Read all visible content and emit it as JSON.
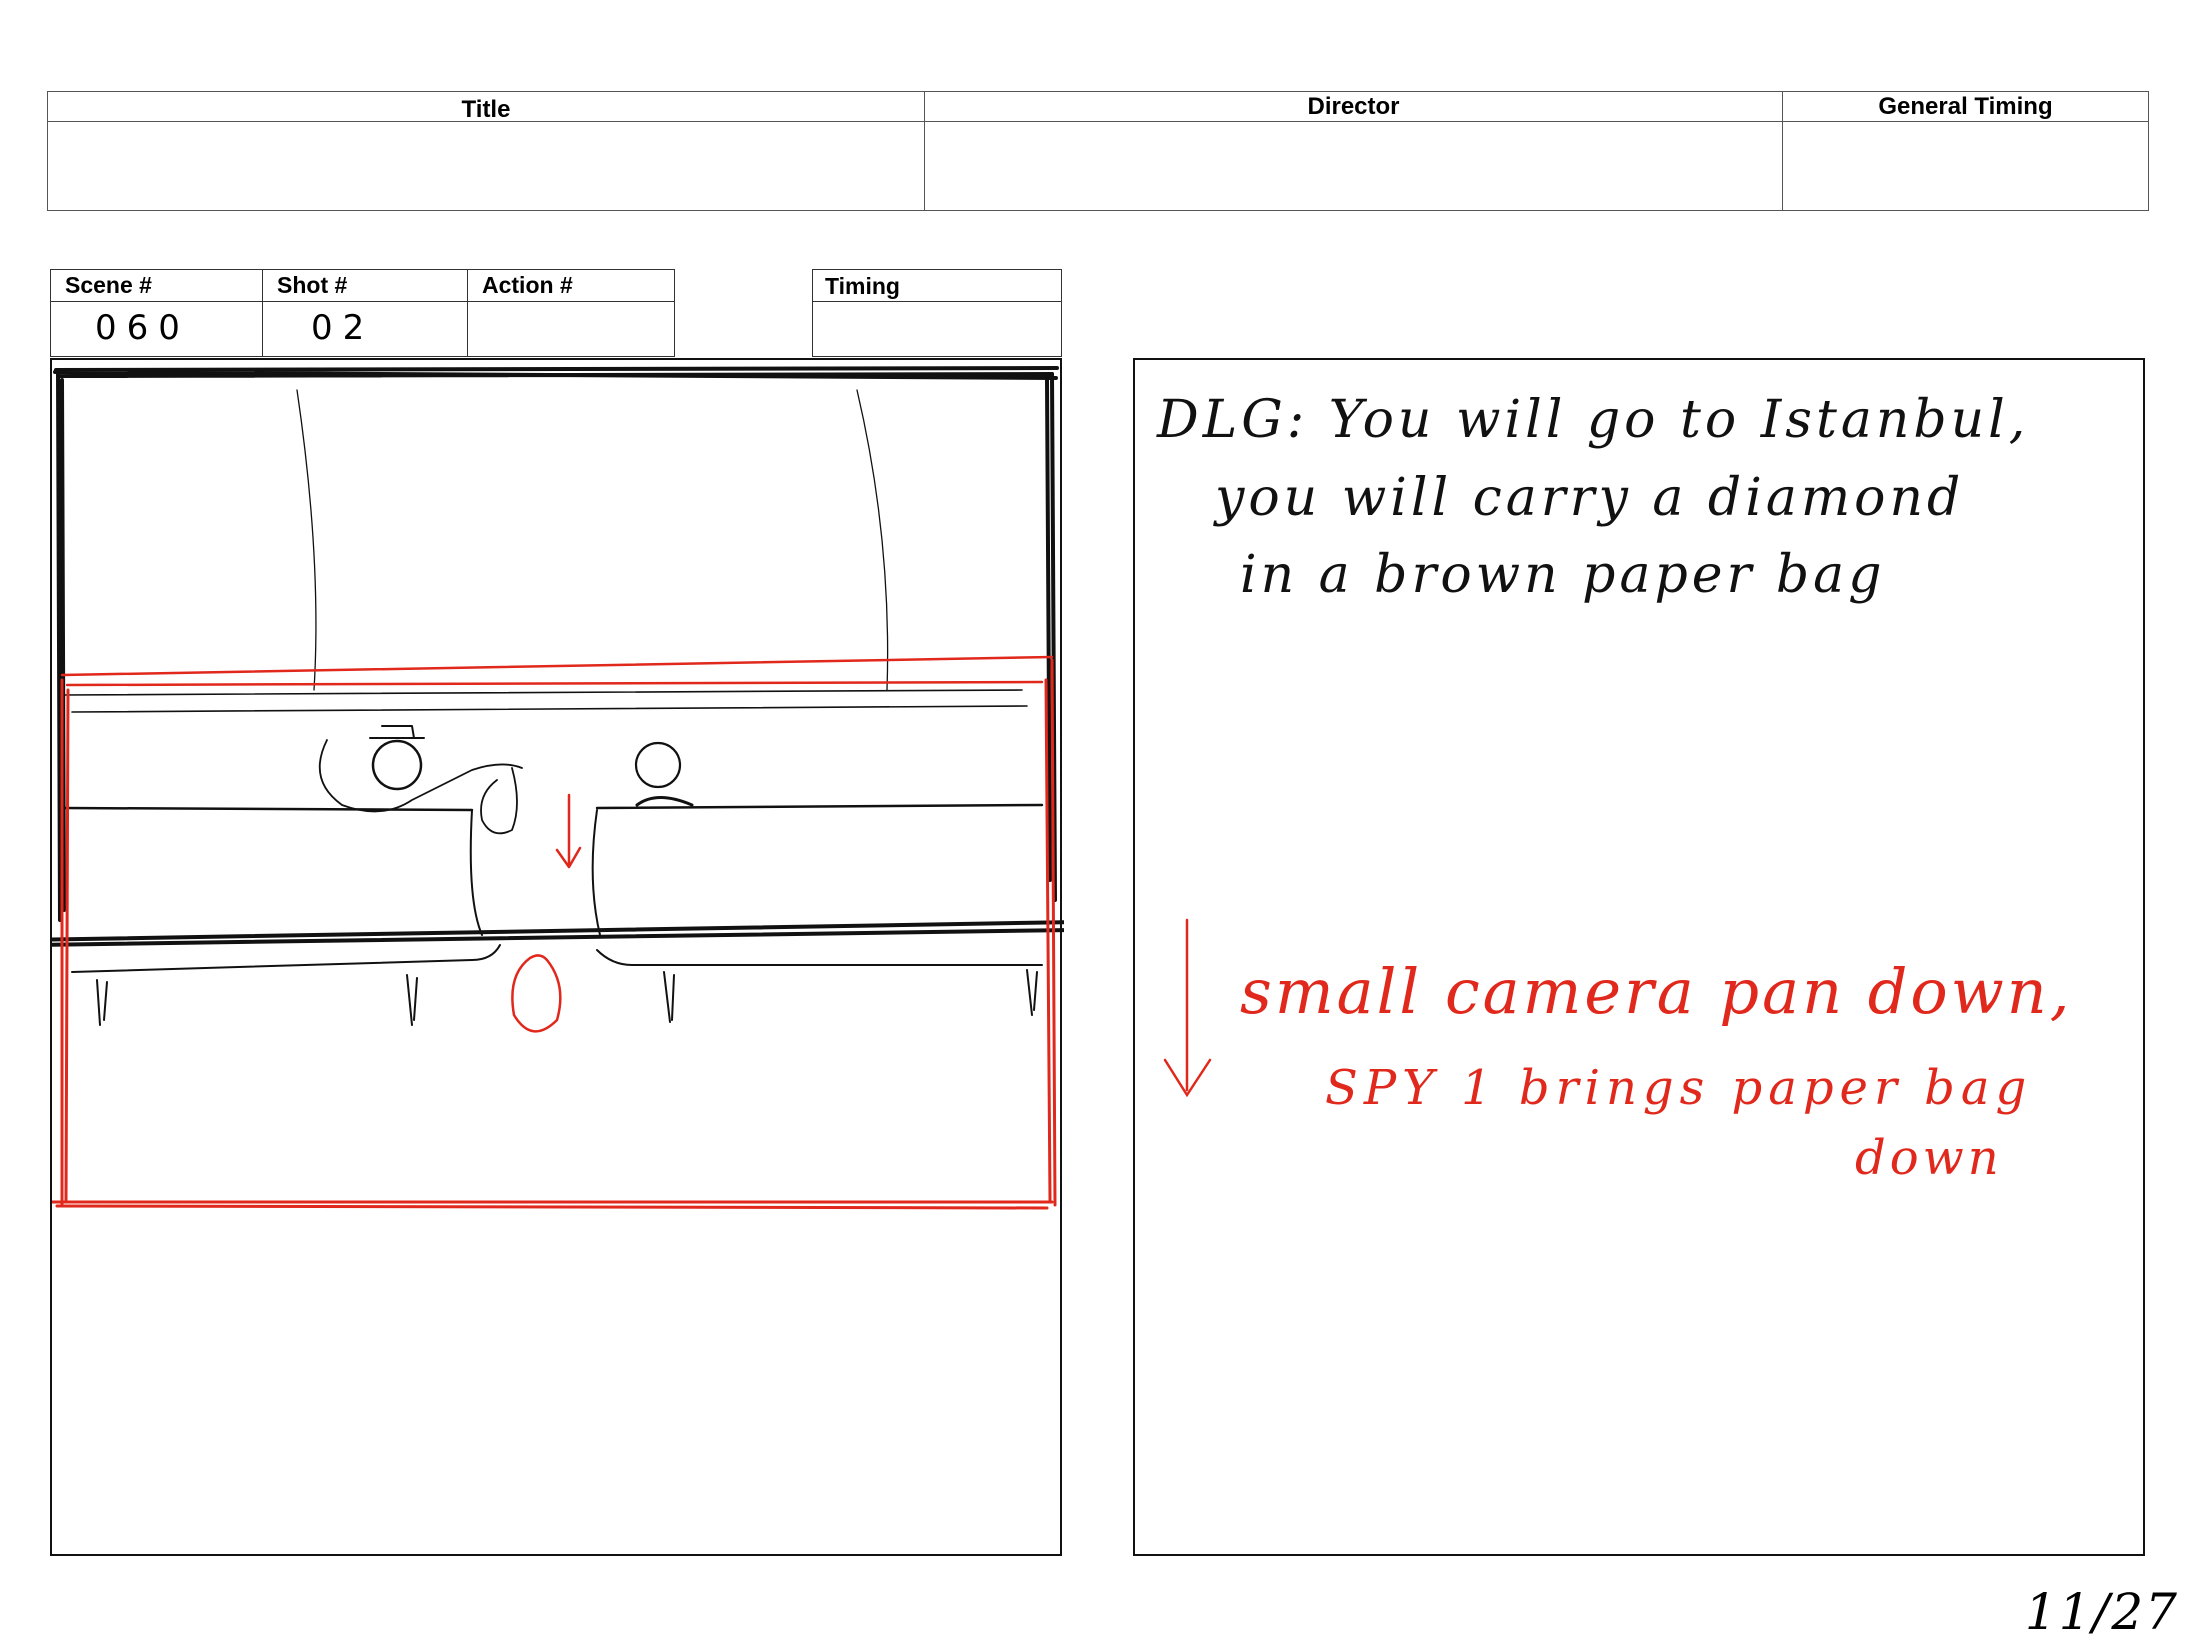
{
  "header": {
    "title_label": "Title",
    "director_label": "Director",
    "general_timing_label": "General Timing"
  },
  "info": {
    "scene_label": "Scene #",
    "scene_value": "060",
    "shot_label": "Shot #",
    "shot_value": "02",
    "action_label": "Action #",
    "timing_label": "Timing"
  },
  "notes": {
    "dialogue_line1": "DLG: You will go to Istanbul,",
    "dialogue_line2": "you will carry a diamond",
    "dialogue_line3": "in a brown paper bag",
    "camera_line1": "small camera pan down,",
    "camera_line2": "SPY 1 brings paper bag",
    "camera_line3": "down"
  },
  "page_number": "11/27",
  "colors": {
    "sketch": "#111111",
    "annotation_red": "#e0281c"
  }
}
